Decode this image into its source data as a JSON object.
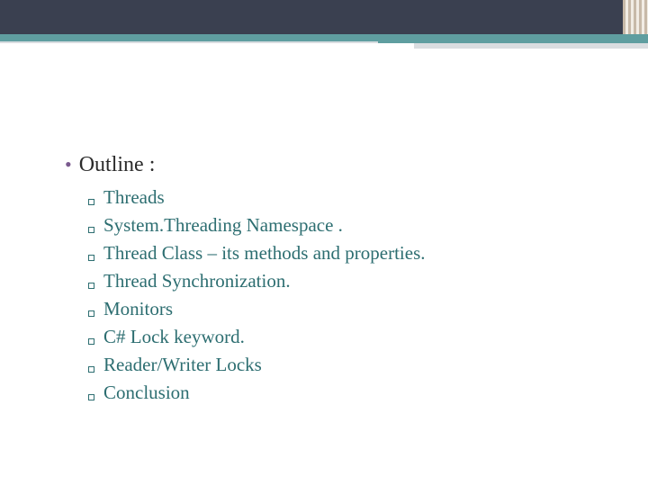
{
  "colors": {
    "header_dark": "#3a4050",
    "header_teal": "#5f9ea0",
    "header_gray": "#d9dde0",
    "bullet_dot": "#7a5a8e",
    "sub_text": "#2d6e71"
  },
  "content": {
    "heading": "Outline :",
    "items": [
      "Threads",
      "System.Threading Namespace .",
      "Thread Class – its methods and properties.",
      "Thread Synchronization.",
      "Monitors",
      "C# Lock keyword.",
      "Reader/Writer Locks",
      "Conclusion"
    ]
  }
}
